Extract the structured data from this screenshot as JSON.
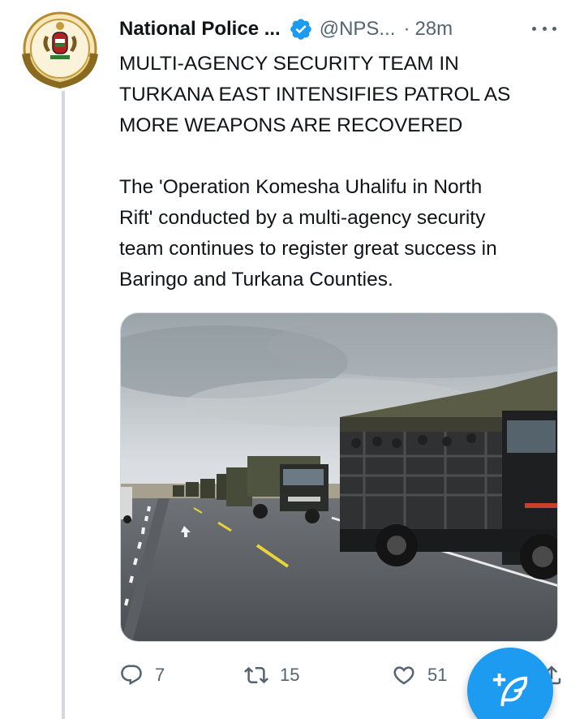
{
  "tweet": {
    "author_name": "National Police ...",
    "author_handle": "@NPS...",
    "separator": "·",
    "time_ago": "28m",
    "headline": "MULTI-AGENCY SECURITY TEAM IN\nTURKANA EAST INTENSIFIES  PATROL AS\nMORE WEAPONS ARE RECOVERED",
    "paragraph": "The 'Operation Komesha Uhalifu in North\nRift' conducted by a multi-agency security\nteam continues to register great success in\nBaringo and Turkana Counties.",
    "media_alt": "Convoy of security trucks driving on a road"
  },
  "actions": {
    "reply_count": "7",
    "retweet_count": "15",
    "like_count": "51"
  },
  "avatar_text": "NATIONAL POLICE SERVICE",
  "icons": {
    "verified": "verified-badge-icon",
    "more": "more-options-icon",
    "reply": "reply-icon",
    "retweet": "retweet-icon",
    "like": "heart-icon",
    "share": "share-icon",
    "compose": "compose-tweet-icon"
  },
  "colors": {
    "accent": "#1d9bf0",
    "text": "#0f1419",
    "secondary_text": "#536471",
    "divider": "#cfd9de"
  }
}
